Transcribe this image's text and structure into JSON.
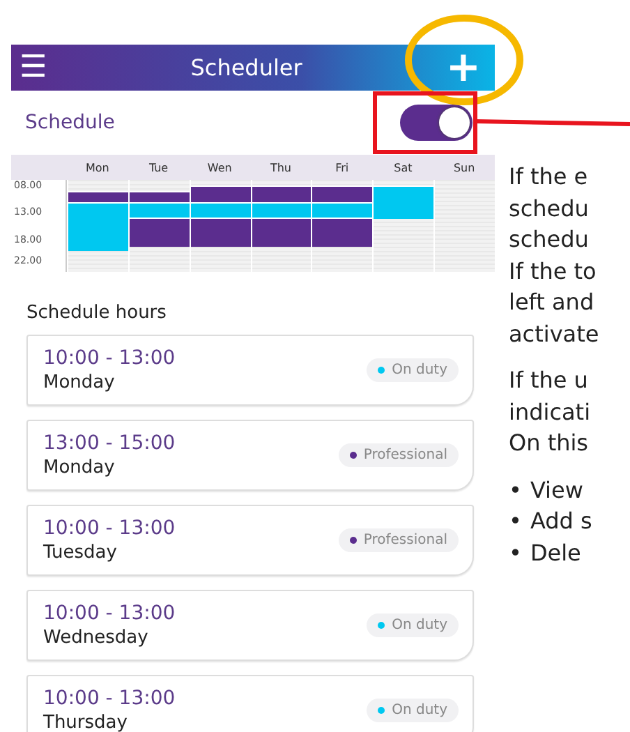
{
  "header": {
    "menu_icon": "☰",
    "title": "Scheduler",
    "add_icon": "+"
  },
  "schedule_toggle": {
    "label": "Schedule",
    "on": true
  },
  "week_grid": {
    "days": [
      "Mon",
      "Tue",
      "Wen",
      "Thu",
      "Fri",
      "Sat",
      "Sun"
    ],
    "rows": [
      {
        "cells": [
          {
            "kind": "free"
          },
          {
            "kind": "free"
          },
          {
            "kind": "free"
          },
          {
            "kind": "free"
          },
          {
            "kind": "free"
          },
          {
            "kind": "free"
          },
          {
            "kind": "free"
          }
        ]
      },
      {
        "time": "08.00",
        "cells": [
          {
            "kind": "free"
          },
          {
            "kind": "free"
          },
          {
            "kind": "professional"
          },
          {
            "kind": "professional"
          },
          {
            "kind": "professional"
          },
          {
            "kind": "on_duty"
          },
          {
            "kind": "free"
          }
        ]
      },
      {
        "cells": [
          {
            "kind": "professional"
          },
          {
            "kind": "professional"
          },
          {
            "kind": "professional"
          },
          {
            "kind": "professional"
          },
          {
            "kind": "professional"
          },
          {
            "kind": "on_duty"
          },
          {
            "kind": "free"
          }
        ]
      },
      {
        "cells": [
          {
            "kind": "professional"
          },
          {
            "kind": "professional"
          },
          {
            "kind": "professional"
          },
          {
            "kind": "professional"
          },
          {
            "kind": "professional"
          },
          {
            "kind": "on_duty"
          },
          {
            "kind": "free"
          }
        ]
      },
      {
        "cells": [
          {
            "kind": "on_duty"
          },
          {
            "kind": "on_duty"
          },
          {
            "kind": "on_duty"
          },
          {
            "kind": "on_duty"
          },
          {
            "kind": "on_duty"
          },
          {
            "kind": "on_duty"
          },
          {
            "kind": "free"
          }
        ]
      },
      {
        "cells": [
          {
            "kind": "on_duty"
          },
          {
            "kind": "on_duty"
          },
          {
            "kind": "on_duty"
          },
          {
            "kind": "on_duty"
          },
          {
            "kind": "on_duty"
          },
          {
            "kind": "on_duty"
          },
          {
            "kind": "free"
          }
        ]
      },
      {
        "time": "13.00",
        "cells": [
          {
            "kind": "on_duty"
          },
          {
            "kind": "on_duty"
          },
          {
            "kind": "on_duty"
          },
          {
            "kind": "on_duty"
          },
          {
            "kind": "on_duty"
          },
          {
            "kind": "on_duty"
          },
          {
            "kind": "free"
          }
        ]
      },
      {
        "cells": [
          {
            "kind": "on_duty"
          },
          {
            "kind": "professional"
          },
          {
            "kind": "professional"
          },
          {
            "kind": "professional"
          },
          {
            "kind": "professional"
          },
          {
            "kind": "free"
          },
          {
            "kind": "free"
          }
        ]
      },
      {
        "cells": [
          {
            "kind": "on_duty"
          },
          {
            "kind": "professional"
          },
          {
            "kind": "professional"
          },
          {
            "kind": "professional"
          },
          {
            "kind": "professional"
          },
          {
            "kind": "free"
          },
          {
            "kind": "free"
          }
        ]
      },
      {
        "cells": [
          {
            "kind": "on_duty"
          },
          {
            "kind": "professional"
          },
          {
            "kind": "professional"
          },
          {
            "kind": "professional"
          },
          {
            "kind": "professional"
          },
          {
            "kind": "free"
          },
          {
            "kind": "free"
          }
        ]
      },
      {
        "cells": [
          {
            "kind": "on_duty"
          },
          {
            "kind": "professional"
          },
          {
            "kind": "professional"
          },
          {
            "kind": "professional"
          },
          {
            "kind": "professional"
          },
          {
            "kind": "free"
          },
          {
            "kind": "free"
          }
        ]
      },
      {
        "time": "18.00",
        "cells": [
          {
            "kind": "on_duty"
          },
          {
            "kind": "professional"
          },
          {
            "kind": "professional"
          },
          {
            "kind": "professional"
          },
          {
            "kind": "professional"
          },
          {
            "kind": "free"
          },
          {
            "kind": "free"
          }
        ]
      },
      {
        "cells": [
          {
            "kind": "on_duty"
          },
          {
            "kind": "free"
          },
          {
            "kind": "free"
          },
          {
            "kind": "free"
          },
          {
            "kind": "free"
          },
          {
            "kind": "free"
          },
          {
            "kind": "free"
          }
        ]
      },
      {
        "cells": [
          {
            "kind": "free"
          },
          {
            "kind": "free"
          },
          {
            "kind": "free"
          },
          {
            "kind": "free"
          },
          {
            "kind": "free"
          },
          {
            "kind": "free"
          },
          {
            "kind": "free"
          }
        ]
      },
      {
        "cells": [
          {
            "kind": "free"
          },
          {
            "kind": "free"
          },
          {
            "kind": "free"
          },
          {
            "kind": "free"
          },
          {
            "kind": "free"
          },
          {
            "kind": "free"
          },
          {
            "kind": "free"
          }
        ]
      },
      {
        "time": "22.00",
        "cells": [
          {
            "kind": "free"
          },
          {
            "kind": "free"
          },
          {
            "kind": "free"
          },
          {
            "kind": "free"
          },
          {
            "kind": "free"
          },
          {
            "kind": "free"
          },
          {
            "kind": "free"
          }
        ]
      },
      {
        "cells": [
          {
            "kind": "free"
          },
          {
            "kind": "free"
          },
          {
            "kind": "free"
          },
          {
            "kind": "free"
          },
          {
            "kind": "free"
          },
          {
            "kind": "free"
          },
          {
            "kind": "free"
          }
        ]
      }
    ]
  },
  "hours_title": "Schedule hours",
  "hours": [
    {
      "time": "10:00 - 13:00",
      "day": "Monday",
      "status": "On duty",
      "color": "#00c8f0"
    },
    {
      "time": "13:00 - 15:00",
      "day": "Monday",
      "status": "Professional",
      "color": "#5b2d8e"
    },
    {
      "time": "10:00 - 13:00",
      "day": "Tuesday",
      "status": "Professional",
      "color": "#5b2d8e"
    },
    {
      "time": "10:00 - 13:00",
      "day": "Wednesday",
      "status": "On duty",
      "color": "#00c8f0"
    },
    {
      "time": "10:00 - 13:00",
      "day": "Thursday",
      "status": "On duty",
      "color": "#00c8f0"
    }
  ],
  "notes": {
    "paragraphs": [
      [
        "If the e",
        "schedu",
        "schedu",
        "If the to",
        "left and",
        "activate"
      ],
      [
        "If the u",
        "indicati",
        "On this"
      ]
    ],
    "bullets": [
      {
        "bullet": "•",
        "text": "View"
      },
      {
        "bullet": "•",
        "text": "Add s"
      },
      {
        "bullet": "•",
        "text": "Dele"
      }
    ]
  }
}
